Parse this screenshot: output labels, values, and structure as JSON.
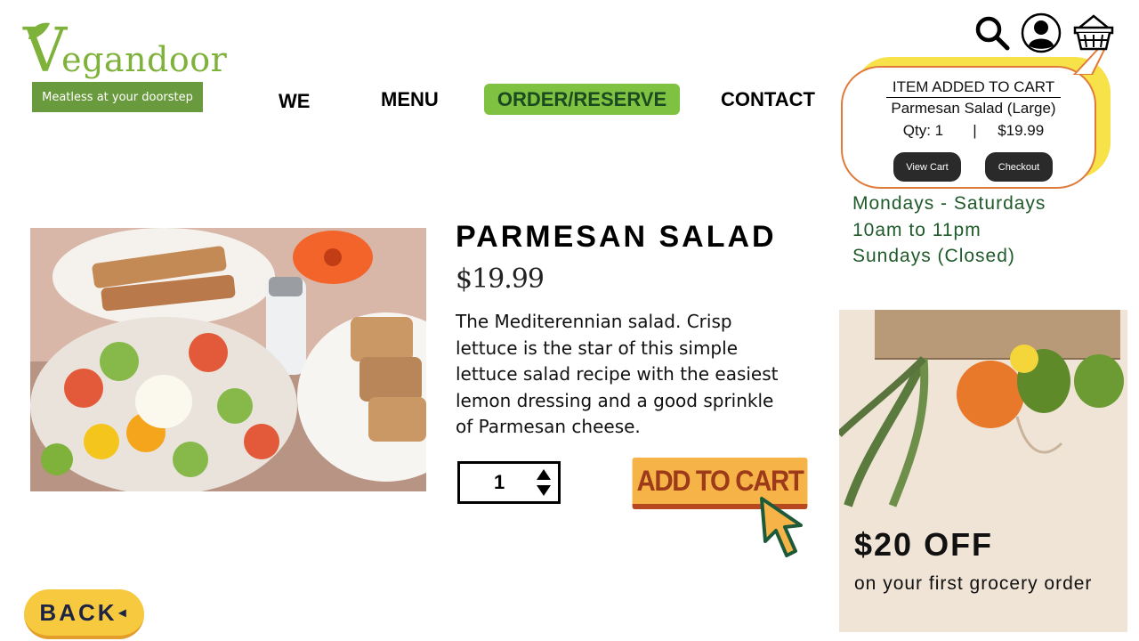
{
  "brand": {
    "name_first_letter": "V",
    "name_rest": "egandoor",
    "tagline": "Meatless at your doorstep",
    "accent_color": "#7fb23a"
  },
  "nav": {
    "items": [
      {
        "label": "WE"
      },
      {
        "label": "MENU"
      },
      {
        "label": "ORDER/RESERVE",
        "active": true
      },
      {
        "label": "CONTACT"
      }
    ]
  },
  "header_icons": [
    "search-icon",
    "user-account-icon",
    "shopping-basket-icon"
  ],
  "cart_popup": {
    "title": "ITEM ADDED TO CART",
    "item": "Parmesan Salad  (Large)",
    "qty_line": "Qty: 1       |     $19.99",
    "view_cart_label": "View Cart",
    "checkout_label": "Checkout"
  },
  "hours": {
    "line1": "Mondays - Saturdays",
    "line2": "10am to 11pm",
    "line3": "Sundays (Closed)"
  },
  "product": {
    "title": "PARMESAN SALAD",
    "price": "$19.99",
    "description": "The Mediterennian salad. Crisp lettuce is the star of this simple lettuce salad recipe with the easiest lemon dressing and a good sprinkle of Parmesan cheese.",
    "quantity": "1",
    "add_to_cart_label": "ADD TO CART"
  },
  "back": {
    "label": "BACK",
    "arrow": "◂"
  },
  "promo": {
    "title": "$20 OFF",
    "subtitle": "on your first grocery order"
  }
}
